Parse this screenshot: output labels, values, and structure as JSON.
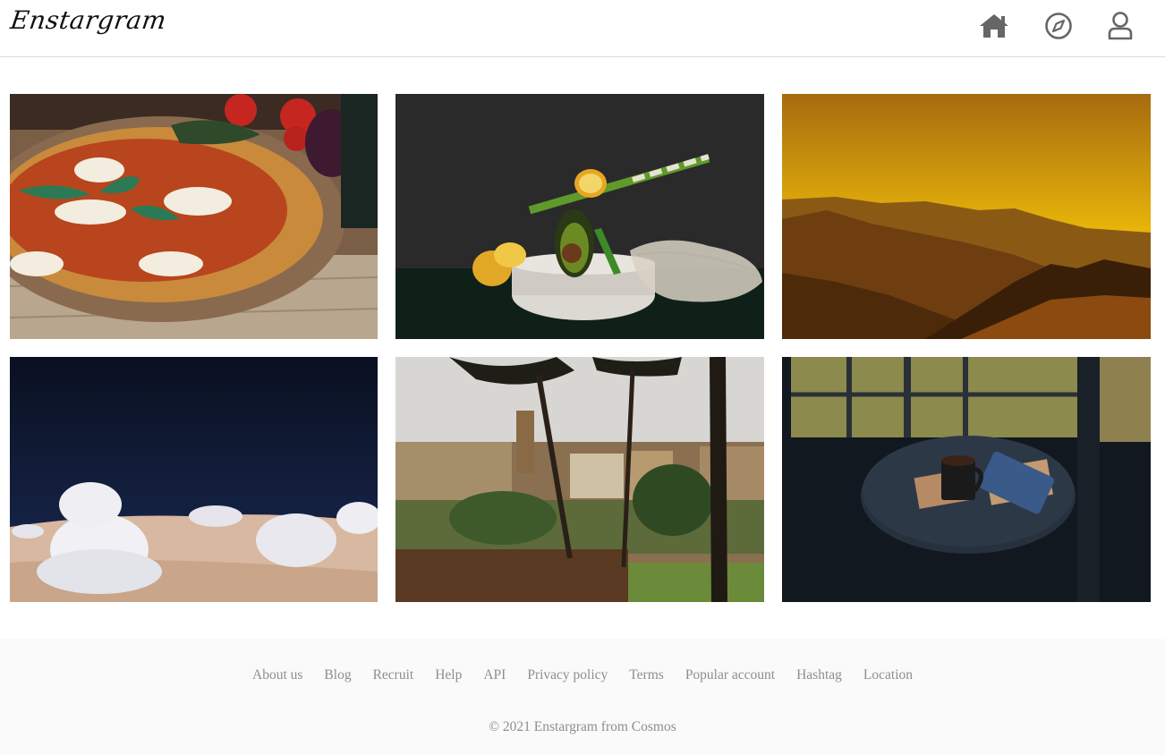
{
  "header": {
    "logo": "Enstargram",
    "icons": [
      "home-icon",
      "compass-icon",
      "user-icon"
    ]
  },
  "posts": [
    {
      "subject": "pizza"
    },
    {
      "subject": "still-life-avocado-lemon"
    },
    {
      "subject": "golden-mountains"
    },
    {
      "subject": "snowy-desert-bushes"
    },
    {
      "subject": "rome-ruins-pines"
    },
    {
      "subject": "coffee-table-window"
    }
  ],
  "footer": {
    "links": [
      "About us",
      "Blog",
      "Recruit",
      "Help",
      "API",
      "Privacy policy",
      "Terms",
      "Popular account",
      "Hashtag",
      "Location"
    ],
    "copyright": "© 2021 Enstargram from Cosmos"
  },
  "colors": {
    "border": "#dbdbdb",
    "icon": "#666666",
    "footer_bg": "#fafafa",
    "footer_text": "#8e8e8e"
  }
}
